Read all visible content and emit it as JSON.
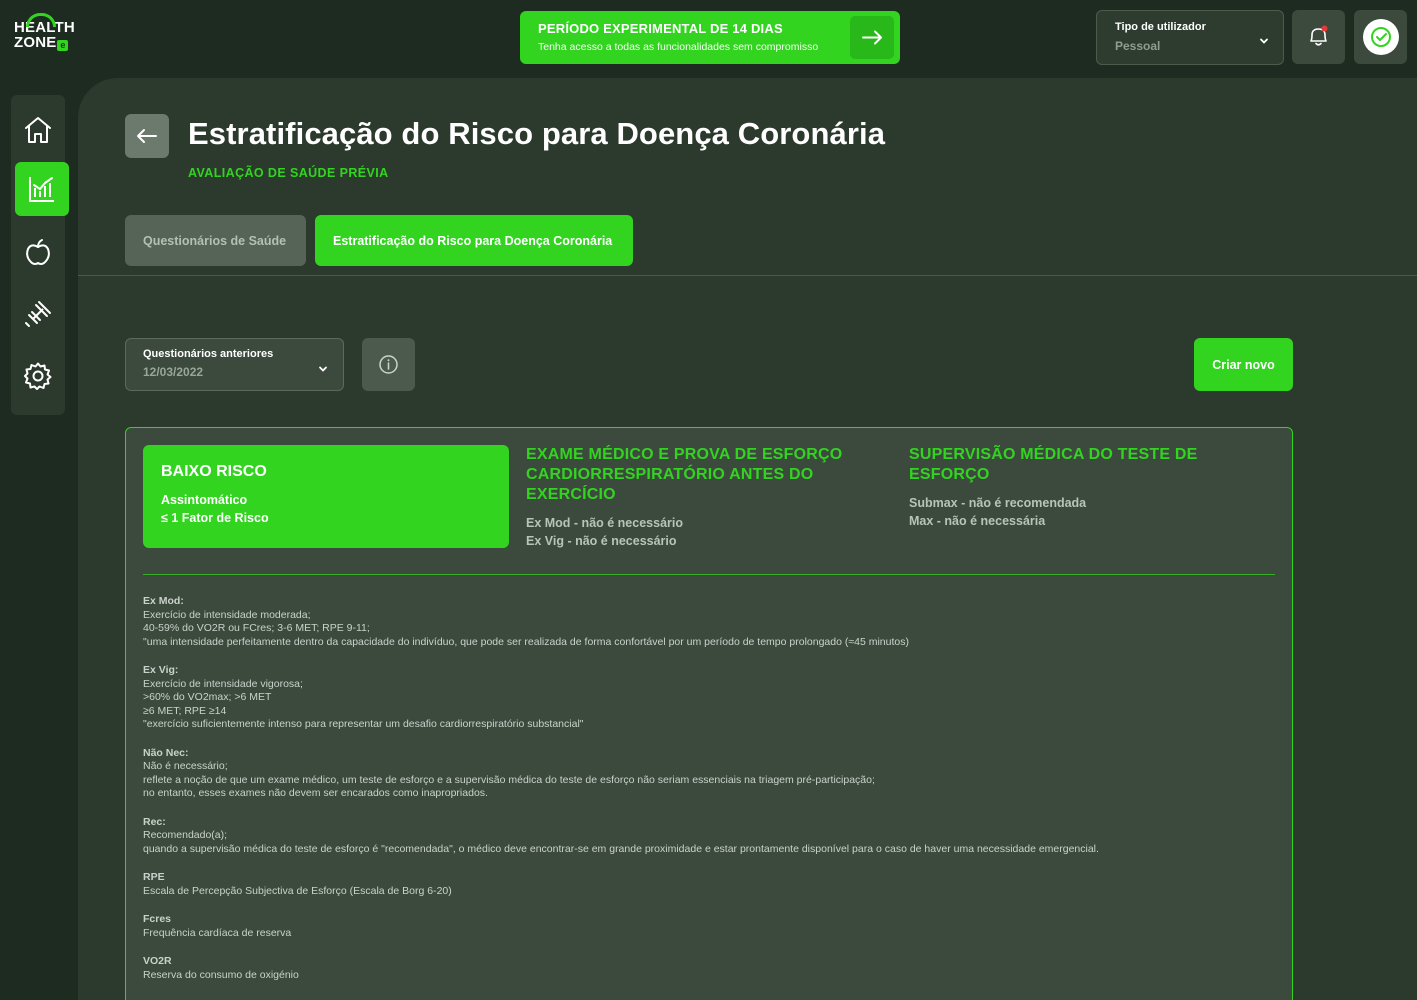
{
  "brand": {
    "line1": "HEALTH",
    "line2": "ZONE",
    "badge": "e"
  },
  "trial_banner": {
    "title": "PERÍODO EXPERIMENTAL DE 14 DIAS",
    "subtitle": "Tenha acesso a todas as funcionalidades sem compromisso",
    "icon": "arrow-right-icon"
  },
  "user_type": {
    "label": "Tipo de utilizador",
    "value": "Pessoal"
  },
  "header_icons": [
    "bell-icon",
    "profile-icon"
  ],
  "sidebar": {
    "items": [
      {
        "name": "home",
        "icon": "home-icon",
        "active": false
      },
      {
        "name": "stats",
        "icon": "chart-icon",
        "active": true
      },
      {
        "name": "nutrition",
        "icon": "apple-icon",
        "active": false
      },
      {
        "name": "exercise",
        "icon": "dumbbell-icon",
        "active": false
      },
      {
        "name": "settings",
        "icon": "gear-icon",
        "active": false
      }
    ]
  },
  "page": {
    "title": "Estratificação do Risco para Doença Coronária",
    "subtitle": "AVALIAÇÃO DE SAÚDE PRÉVIA"
  },
  "tabs": [
    {
      "label": "Questionários de Saúde",
      "active": false
    },
    {
      "label": "Estratificação do Risco para Doença Coronária",
      "active": true
    }
  ],
  "previous": {
    "label": "Questionários anteriores",
    "value": "12/03/2022"
  },
  "create_label": "Criar novo",
  "result": {
    "risk": {
      "title": "BAIXO RISCO",
      "lines": [
        "Assintomático",
        "≤ 1 Fator de Risco"
      ]
    },
    "exam": {
      "title": "EXAME MÉDICO E PROVA DE ESFORÇO CARDIORRESPIRATÓRIO ANTES DO EXERCÍCIO",
      "lines": [
        "Ex Mod - não é necessário",
        "Ex Vig - não é necessário"
      ]
    },
    "supervision": {
      "title": "SUPERVISÃO MÉDICA DO TESTE DE ESFORÇO",
      "lines": [
        "Submax - não é recomendada",
        "Max - não é necessária"
      ]
    }
  },
  "definitions": [
    {
      "term": "Ex Mod:",
      "lines": [
        "Exercício de intensidade moderada;",
        "40-59% do VO2R ou FCres; 3-6 MET; RPE 9-11;",
        "\"uma intensidade perfeitamente dentro da capacidade do indivíduo, que pode ser realizada de forma confortável por um período de tempo prolongado (≈45 minutos)"
      ]
    },
    {
      "term": "Ex Vig:",
      "lines": [
        "Exercício de intensidade vigorosa;",
        ">60% do VO2max; >6 MET",
        "≥6 MET; RPE ≥14",
        "\"exercício suficientemente intenso para representar um desafio cardiorrespiratório substancial\""
      ]
    },
    {
      "term": "Não Nec:",
      "lines": [
        "Não é necessário;",
        "reflete a noção de que um exame médico, um teste de esforço e a supervisão médica do teste de esforço não seriam essenciais na triagem pré-participação;",
        "no entanto, esses exames não devem ser encarados como inapropriados."
      ]
    },
    {
      "term": "Rec:",
      "lines": [
        "Recomendado(a);",
        "quando a supervisão médica do teste de esforço é \"recomendada\", o médico deve encontrar-se em grande proximidade e estar prontamente disponível para o caso de haver uma necessidade emergencial."
      ]
    },
    {
      "term": "RPE",
      "lines": [
        "Escala de Percepção Subjectiva de Esforço (Escala de Borg 6-20)"
      ]
    },
    {
      "term": "Fcres",
      "lines": [
        "Frequência cardíaca de reserva"
      ]
    },
    {
      "term": "VO2R",
      "lines": [
        "Reserva do consumo de oxigénio"
      ]
    }
  ],
  "colors": {
    "accent": "#32d420",
    "background": "#1e2b20",
    "panel": "#2c3a2e",
    "card": "#3c4a3e"
  }
}
